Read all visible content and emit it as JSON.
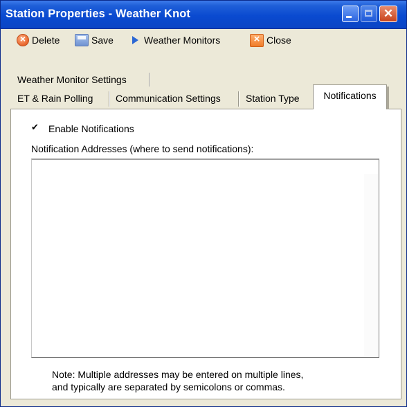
{
  "window": {
    "title": "Station Properties - Weather Knot"
  },
  "toolbar": {
    "delete_label": "Delete",
    "save_label": "Save",
    "monitors_label": "Weather Monitors",
    "close_label": "Close"
  },
  "tabs": {
    "row1": [
      "Weather Monitor Settings"
    ],
    "row2": [
      "ET & Rain Polling",
      "Communication Settings",
      "Station Type",
      "Notifications"
    ],
    "active": "Notifications"
  },
  "notifications": {
    "enable_label": "Enable Notifications",
    "enable_checked": true,
    "addresses_label": "Notification Addresses (where to send notifications):",
    "addresses_value": "",
    "note_line1": "Note: Multiple addresses may be entered on multiple lines,",
    "note_line2": "and typically are separated by semicolons or commas."
  },
  "icons": {
    "delete": "delete-icon",
    "save": "save-icon",
    "monitors": "play-arrow-icon",
    "close": "close-icon"
  }
}
